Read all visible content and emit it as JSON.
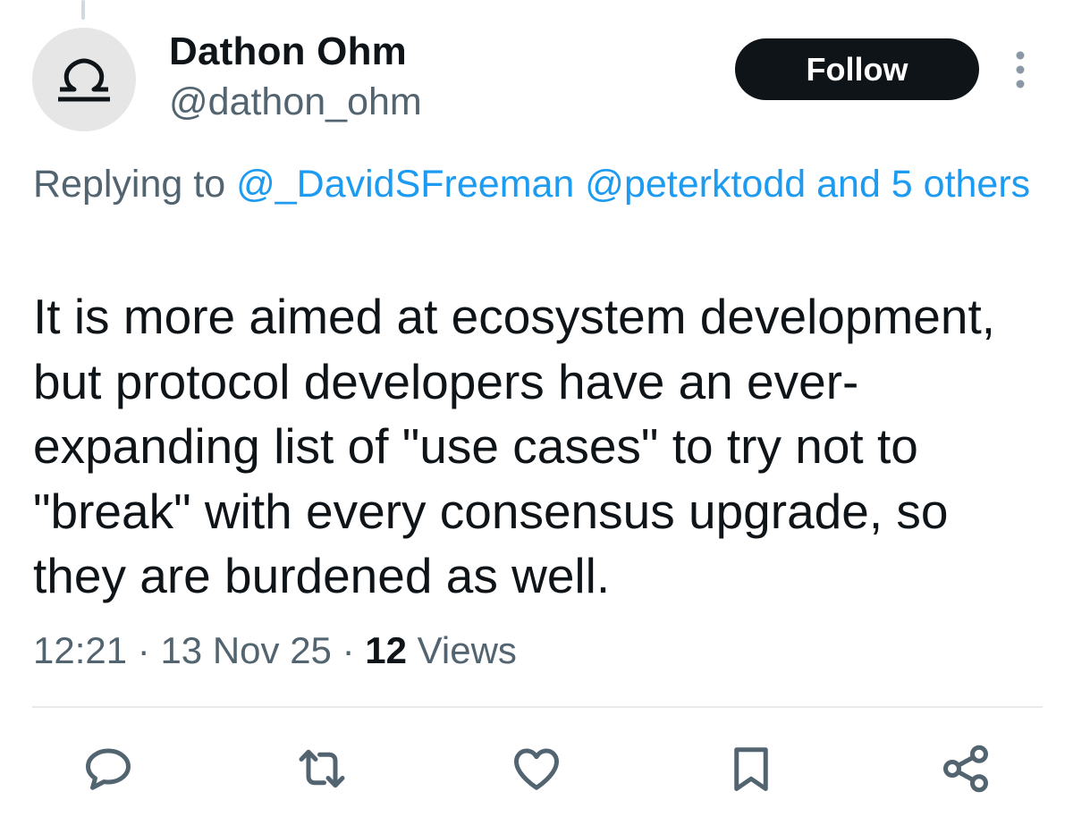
{
  "author": {
    "display_name": "Dathon Ohm",
    "handle": "@dathon_ohm",
    "avatar_icon": "libra-symbol-icon"
  },
  "follow_label": "Follow",
  "reply_context": {
    "prefix": "Replying to",
    "mentions": [
      "@_DavidSFreeman",
      "@peterktodd"
    ],
    "others": "and 5 others"
  },
  "tweet_text": "It is more aimed at ecosystem development, but protocol developers have an ever-expanding list of \"use cases\" to try not to \"break\" with every consensus upgrade, so they are burdened as well.",
  "meta": {
    "time": "12:21",
    "date": "13 Nov 25",
    "separator": "·",
    "views_count": "12",
    "views_label": "Views"
  },
  "actions": [
    "reply-icon",
    "retweet-icon",
    "like-icon",
    "bookmark-icon",
    "share-icon"
  ],
  "colors": {
    "link": "#1d9bf0",
    "secondary_text": "#536471",
    "primary_text": "#0f1419",
    "follow_bg": "#0f1419"
  }
}
